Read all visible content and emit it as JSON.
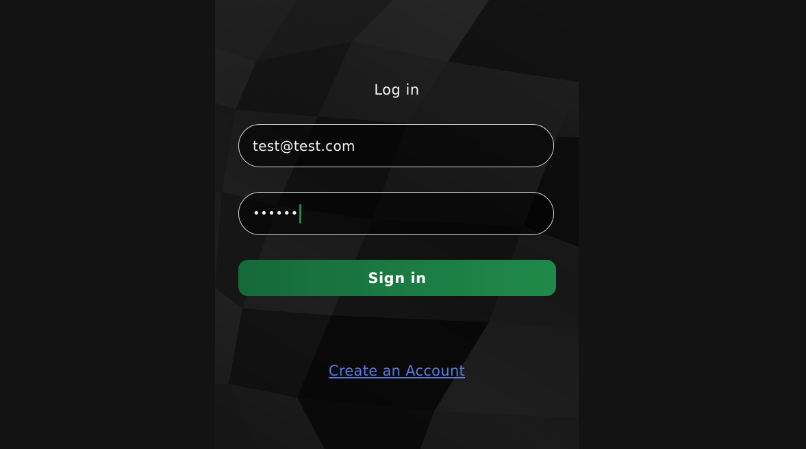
{
  "login": {
    "title": "Log in",
    "email_value": "test@test.com",
    "password_masked": "••••••",
    "signin_label": "Sign in",
    "create_account_label": "Create an Account"
  },
  "colors": {
    "page_background": "#131313",
    "button_green": "#1b7a42",
    "link_blue": "#5a7be0",
    "caret_green": "#1f8a45"
  }
}
